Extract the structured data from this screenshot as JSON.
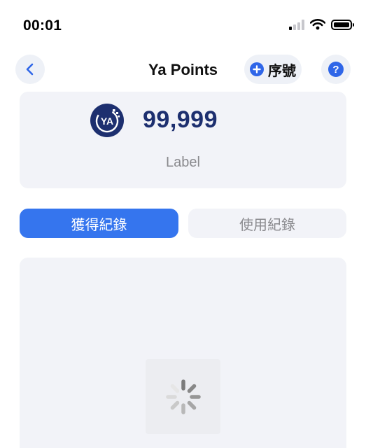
{
  "status_bar": {
    "time": "00:01",
    "icons": [
      "cellular-signal-icon",
      "wifi-icon",
      "battery-icon"
    ]
  },
  "navbar": {
    "back_icon": "chevron-left-icon",
    "title": "Ya Points",
    "serial_button": {
      "icon": "plus-circle-icon",
      "label": "序號"
    },
    "help_icon": "question-circle-icon"
  },
  "points_card": {
    "logo_text": "YA",
    "value": "99,999",
    "label": "Label"
  },
  "tabs": [
    {
      "label": "獲得紀錄",
      "active": true
    },
    {
      "label": "使用紀錄",
      "active": false
    }
  ],
  "records": {
    "loading_icon": "spinner-icon"
  },
  "colors": {
    "accent": "#3575ee",
    "brand_navy": "#1d2f6f",
    "card_bg": "#f2f3f8",
    "muted_text": "#8a8a8e"
  }
}
